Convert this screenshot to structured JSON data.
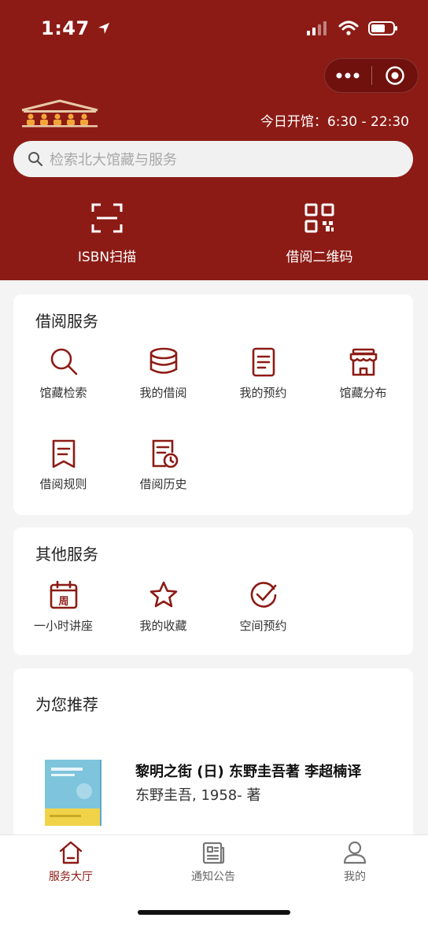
{
  "status_bar": {
    "time": "1:47"
  },
  "header": {
    "hours": "今日开馆：6:30 - 22:30",
    "search": {
      "placeholder": "检索北大馆藏与服务"
    },
    "quick_actions": [
      {
        "label": "ISBN扫描",
        "icon": "scan-icon"
      },
      {
        "label": "借阅二维码",
        "icon": "qr-code-icon"
      }
    ]
  },
  "borrow_services": {
    "title": "借阅服务",
    "items": [
      {
        "label": "馆藏检索",
        "icon": "search-icon"
      },
      {
        "label": "我的借阅",
        "icon": "books-stack-icon"
      },
      {
        "label": "我的预约",
        "icon": "document-icon"
      },
      {
        "label": "馆藏分布",
        "icon": "store-icon"
      },
      {
        "label": "借阅规则",
        "icon": "bookmark-icon"
      },
      {
        "label": "借阅历史",
        "icon": "history-doc-icon"
      }
    ]
  },
  "other_services": {
    "title": "其他服务",
    "items": [
      {
        "label": "一小时讲座",
        "icon": "calendar-icon",
        "icon_text": "周"
      },
      {
        "label": "我的收藏",
        "icon": "star-icon"
      },
      {
        "label": "空间预约",
        "icon": "check-circle-icon"
      }
    ]
  },
  "recommend": {
    "title": "为您推荐",
    "book": {
      "title": "黎明之街 (日) 东野圭吾著 李超楠译",
      "author": "东野圭吾, 1958- 著"
    }
  },
  "tabbar": [
    {
      "label": "服务大厅",
      "icon": "home-icon",
      "active": true
    },
    {
      "label": "通知公告",
      "icon": "newspaper-icon",
      "active": false
    },
    {
      "label": "我的",
      "icon": "user-icon",
      "active": false
    }
  ],
  "colors": {
    "brand": "#8c1b15",
    "background": "#f4f4f4"
  }
}
